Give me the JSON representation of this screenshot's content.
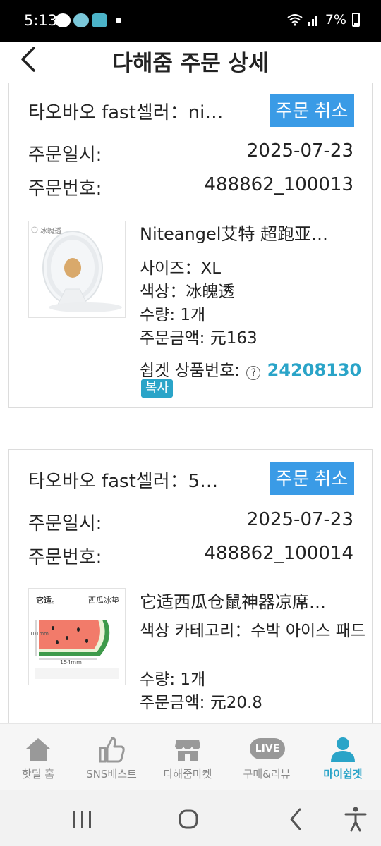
{
  "status_bar": {
    "time": "5:13",
    "battery": "7%"
  },
  "header": {
    "title": "다해줌 주문 상세",
    "back_icon": "chevron-left-icon"
  },
  "orders": [
    {
      "seller": "타오바오 fast셀러：ni…",
      "cancel_label": "주문 취소",
      "date_label": "주문일시:",
      "date": "2025-07-23",
      "number_label": "주문번호:",
      "number": "488862_100013",
      "product": {
        "name": "Niteangel艾特 超跑亚…",
        "size": "사이즈：XL",
        "color": "색상：冰魄透",
        "qty": "수량: 1개",
        "amount": "주문금액: 元163",
        "code_label": "쉽겟 상품번호:",
        "code_help": "?",
        "code": "24208130",
        "copy_label": "복사",
        "thumb_text": "冰魄透"
      }
    },
    {
      "seller": "타오바오 fast셀러：5…",
      "cancel_label": "주문 취소",
      "date_label": "주문일시:",
      "date": "2025-07-23",
      "number_label": "주문번호:",
      "number": "488862_100014",
      "product": {
        "name": "它适西瓜仓鼠神器凉席…",
        "category": "색상 카테고리：수박 아이스 패드",
        "qty": "수량: 1개",
        "amount": "주문금액: 元20.8",
        "thumb_brand": "它适。",
        "thumb_title": "西瓜冰垫",
        "thumb_dim": "154mm",
        "thumb_dim2": "101mm"
      }
    }
  ],
  "bottom_nav": [
    {
      "label": "핫딜 홈",
      "icon": "home-icon",
      "active": false
    },
    {
      "label": "SNS베스트",
      "icon": "thumbs-up-icon",
      "active": false
    },
    {
      "label": "다해줌마켓",
      "icon": "store-icon",
      "active": false
    },
    {
      "label": "구매&리뷰",
      "icon": "live-icon",
      "live_text": "LIVE",
      "active": false
    },
    {
      "label": "마이쉽겟",
      "icon": "person-icon",
      "active": true
    }
  ],
  "colors": {
    "accent": "#2aa4c8",
    "cancel_button": "#3a9be6"
  }
}
